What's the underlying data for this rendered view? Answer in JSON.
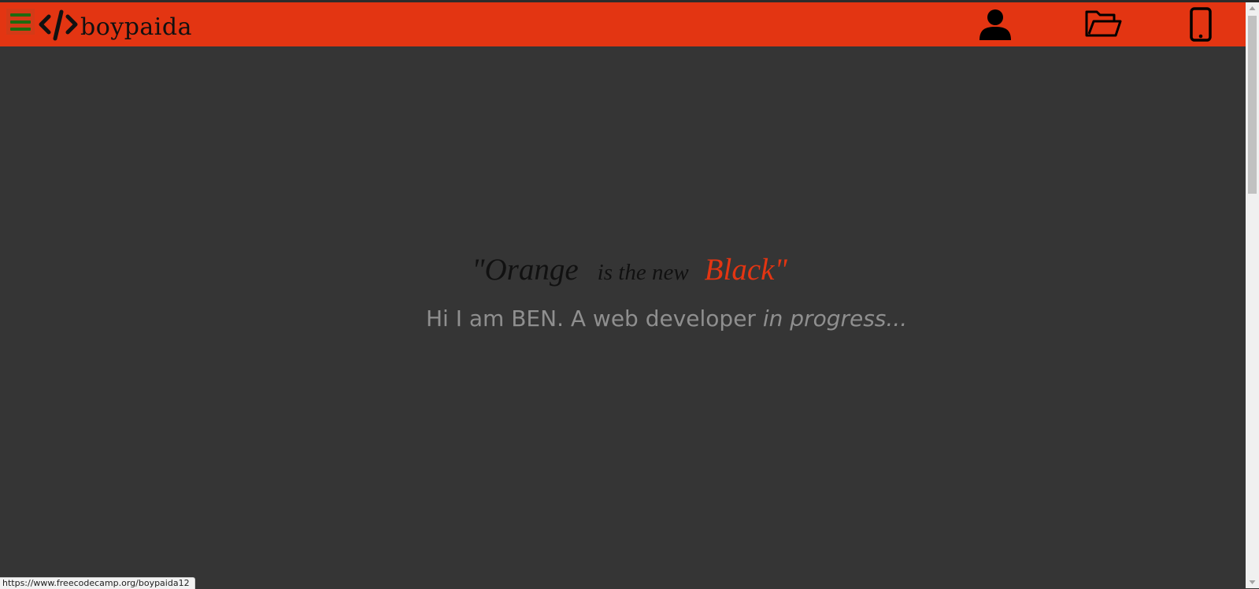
{
  "navbar": {
    "brand_text": "boypaida",
    "brand_icon": "code-brackets-icon",
    "menu_icon": "hamburger-icon",
    "icons": [
      "user-icon",
      "folder-open-icon",
      "mobile-phone-icon"
    ],
    "background_color": "#e33512"
  },
  "hero": {
    "quote_part1": "\"Orange",
    "quote_part2": "is the new",
    "quote_part3": "Black",
    "quote_part4": "\"",
    "intro_plain": "Hi I am BEN.  A web developer ",
    "intro_italic": "in progress..."
  },
  "status_bar": {
    "url": "https://www.freecodecamp.org/boypaida12"
  },
  "colors": {
    "accent": "#e33512",
    "page_background": "#353535",
    "muted_text": "#8f8f8f"
  }
}
